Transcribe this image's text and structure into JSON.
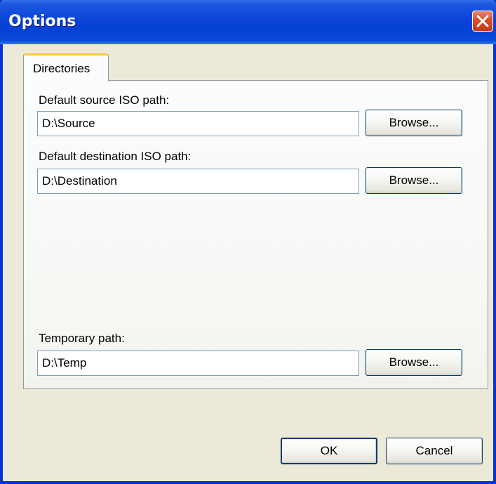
{
  "window": {
    "title": "Options",
    "close_label": "Close"
  },
  "tabs": [
    {
      "label": "Directories",
      "selected": true
    }
  ],
  "directories": {
    "source": {
      "label": "Default source ISO path:",
      "value": "D:\\Source",
      "browse_label": "Browse..."
    },
    "destination": {
      "label": "Default destination ISO path:",
      "value": "D:\\Destination",
      "browse_label": "Browse..."
    },
    "temp": {
      "label": "Temporary path:",
      "value": "D:\\Temp",
      "browse_label": "Browse..."
    }
  },
  "footer": {
    "ok_label": "OK",
    "cancel_label": "Cancel"
  },
  "colors": {
    "titlebar": "#0A44D6",
    "close_button": "#D9502D",
    "tab_highlight": "#FFC83C",
    "dialog_background": "#ECE9D8"
  },
  "icons": {
    "close": "close-x-icon"
  }
}
